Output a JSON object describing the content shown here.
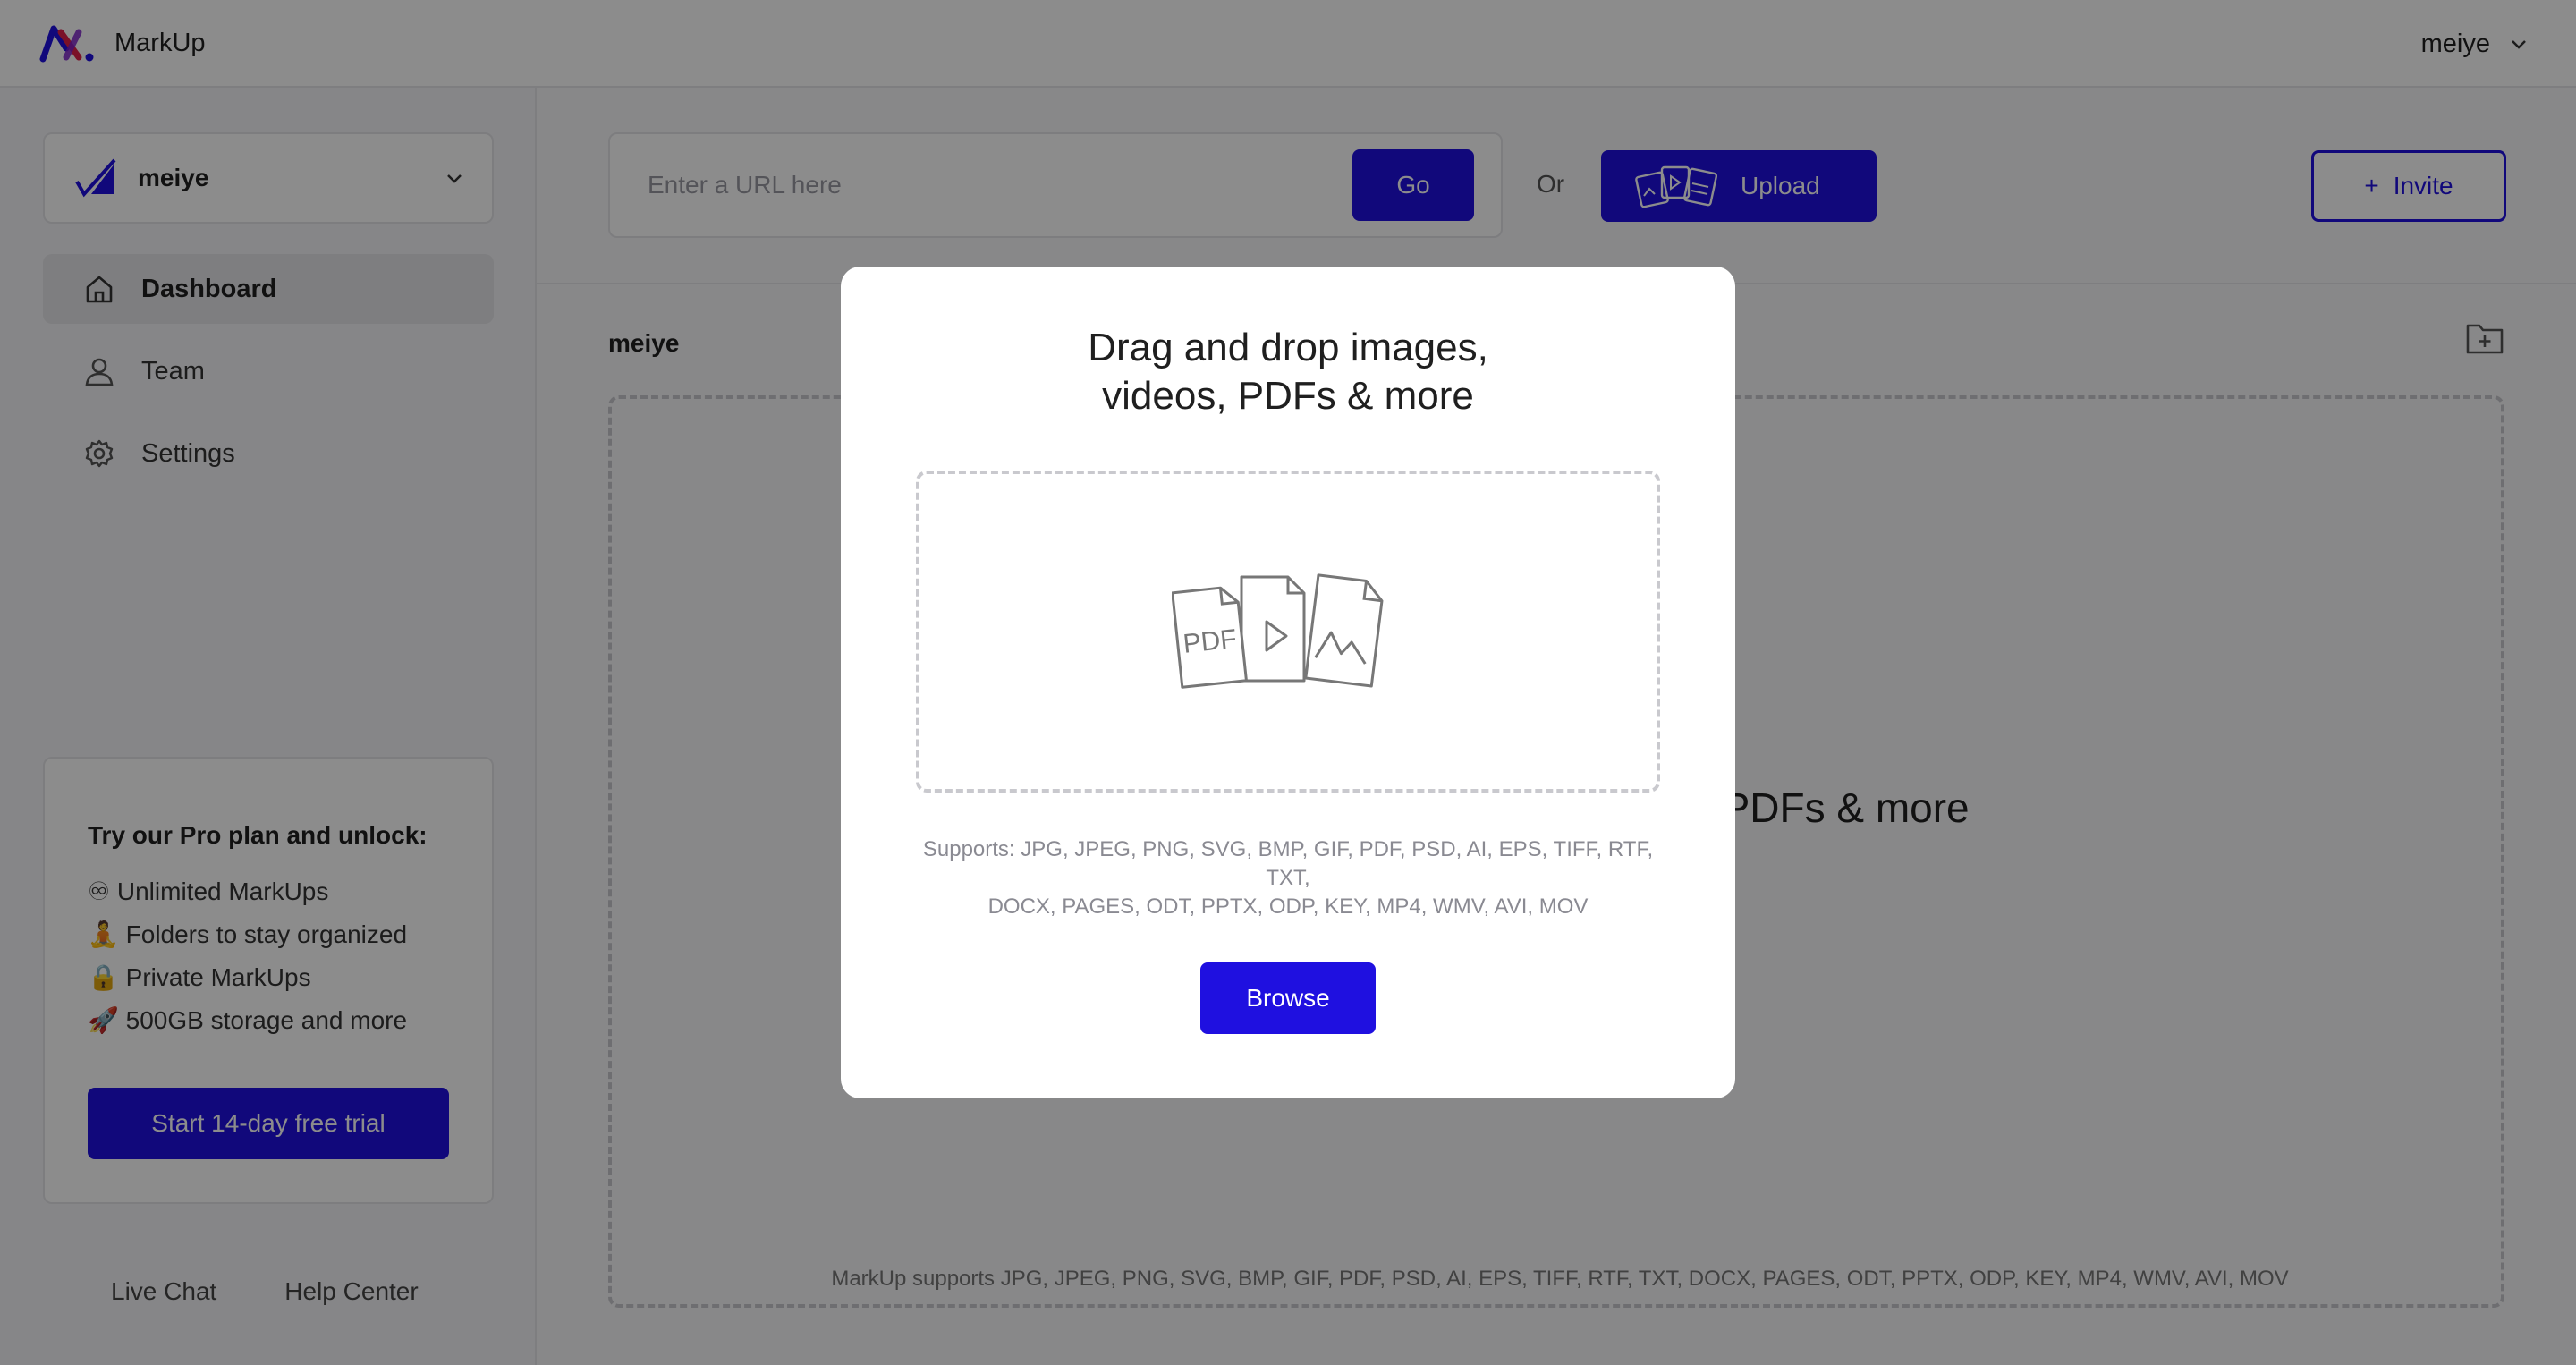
{
  "header": {
    "app_name": "MarkUp",
    "user_name": "meiye"
  },
  "sidebar": {
    "workspace_name": "meiye",
    "nav": [
      {
        "label": "Dashboard",
        "icon": "home-icon",
        "active": true
      },
      {
        "label": "Team",
        "icon": "person-icon",
        "active": false
      },
      {
        "label": "Settings",
        "icon": "gear-icon",
        "active": false
      }
    ],
    "promo": {
      "title": "Try our Pro plan and unlock:",
      "items": [
        "♾ Unlimited MarkUps",
        "🧘 Folders to stay organized",
        "🔒 Private MarkUps",
        "🚀 500GB storage and more"
      ],
      "button": "Start 14-day free trial"
    },
    "links": [
      "Live Chat",
      "Help Center"
    ]
  },
  "toolbar": {
    "url_placeholder": "Enter a URL here",
    "go": "Go",
    "or": "Or",
    "upload": "Upload",
    "invite": "Invite",
    "invite_prefix": "+"
  },
  "main": {
    "folder_label": "meiye",
    "drop_title": "Drag and drop images, videos, PDFs & more",
    "supports": "MarkUp supports JPG, JPEG, PNG, SVG, BMP, GIF, PDF, PSD, AI, EPS, TIFF, RTF, TXT, DOCX, PAGES, ODT, PPTX, ODP, KEY, MP4, WMV, AVI, MOV"
  },
  "modal": {
    "title_line1": "Drag and drop images,",
    "title_line2": "videos, PDFs & more",
    "pdf_label": "PDF",
    "supports_line1": "Supports: JPG, JPEG, PNG, SVG, BMP, GIF, PDF, PSD, AI, EPS, TIFF, RTF, TXT,",
    "supports_line2": "DOCX, PAGES, ODT, PPTX, ODP, KEY, MP4, WMV, AVI, MOV",
    "browse": "Browse"
  },
  "colors": {
    "accent": "#1f10e0",
    "overlay": "rgba(0,0,0,0.45)"
  }
}
